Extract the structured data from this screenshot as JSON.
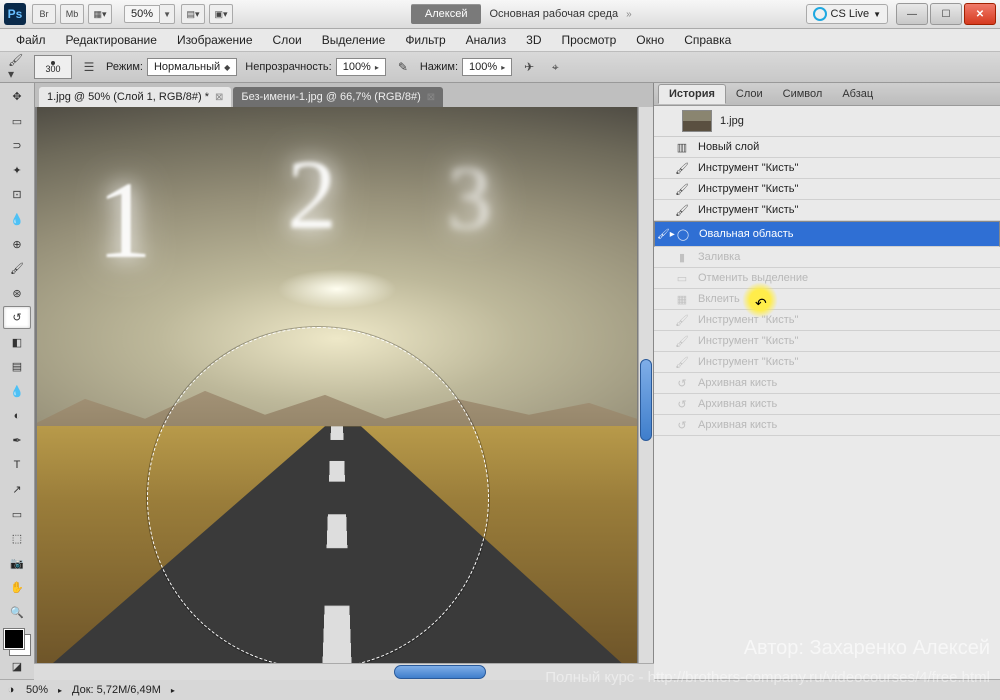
{
  "titlebar": {
    "zoom": "50%",
    "user_label": "Алексей",
    "workspace_label": "Основная рабочая среда",
    "cslive_label": "CS Live"
  },
  "menubar": [
    "Файл",
    "Редактирование",
    "Изображение",
    "Слои",
    "Выделение",
    "Фильтр",
    "Анализ",
    "3D",
    "Просмотр",
    "Окно",
    "Справка"
  ],
  "options": {
    "brush_size": "300",
    "mode_label": "Режим:",
    "mode_value": "Нормальный",
    "opacity_label": "Непрозрачность:",
    "opacity_value": "100%",
    "flow_label": "Нажим:",
    "flow_value": "100%"
  },
  "tabs": [
    {
      "label": "1.jpg @ 50% (Слой 1, RGB/8#) *",
      "active": true
    },
    {
      "label": "Без-имени-1.jpg @ 66,7% (RGB/8#)",
      "active": false
    }
  ],
  "statusbar": {
    "zoom": "50%",
    "doc": "Док: 5,72M/6,49M"
  },
  "panel": {
    "tabs": [
      "История",
      "Слои",
      "Символ",
      "Абзац"
    ],
    "active": 0,
    "snapshot": "1.jpg",
    "rows": [
      {
        "icon": "layer",
        "label": "Новый слой",
        "state": "normal"
      },
      {
        "icon": "brush",
        "label": "Инструмент \"Кисть\"",
        "state": "normal"
      },
      {
        "icon": "brush",
        "label": "Инструмент \"Кисть\"",
        "state": "normal"
      },
      {
        "icon": "brush",
        "label": "Инструмент \"Кисть\"",
        "state": "normal"
      },
      {
        "icon": "ellipse",
        "label": "Овальная область",
        "state": "selected"
      },
      {
        "icon": "fill",
        "label": "Заливка",
        "state": "dim"
      },
      {
        "icon": "desel",
        "label": "Отменить выделение",
        "state": "dim"
      },
      {
        "icon": "paste",
        "label": "Вклеить",
        "state": "dim"
      },
      {
        "icon": "brush",
        "label": "Инструмент \"Кисть\"",
        "state": "dim"
      },
      {
        "icon": "brush",
        "label": "Инструмент \"Кисть\"",
        "state": "dim"
      },
      {
        "icon": "brush",
        "label": "Инструмент \"Кисть\"",
        "state": "dim"
      },
      {
        "icon": "hist",
        "label": "Архивная кисть",
        "state": "dim"
      },
      {
        "icon": "hist",
        "label": "Архивная кисть",
        "state": "dim"
      },
      {
        "icon": "hist",
        "label": "Архивная кисть",
        "state": "dim"
      }
    ]
  },
  "watermark": {
    "line1": "Автор: Захаренко Алексей",
    "line2": "Полный курс - http://brothers-company.ru/videocourses/4/free.html"
  }
}
